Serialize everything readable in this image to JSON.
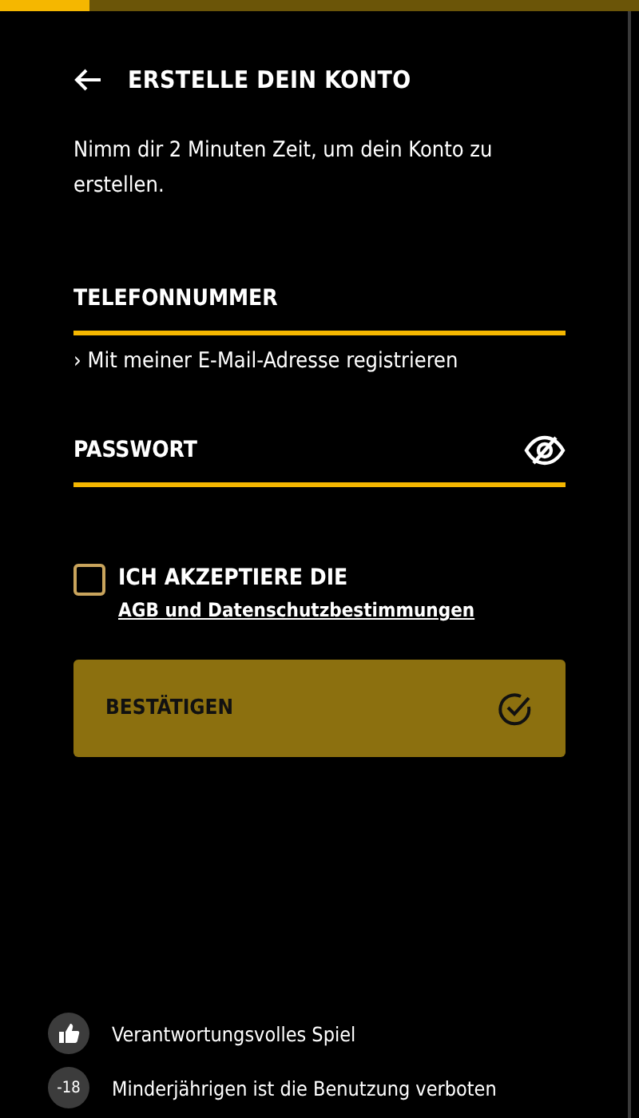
{
  "progress": {
    "level": 0.14
  },
  "header": {
    "title": "ERSTELLE DEIN KONTO"
  },
  "intro": "Nimm dir 2 Minuten Zeit, um dein Konto zu erstellen.",
  "fields": [
    {
      "kind": "phone",
      "placeholder": "TELEFONNUMMER"
    },
    {
      "kind": "password",
      "placeholder": "PASSWORT"
    }
  ],
  "alt_link": "› Mit meiner E-Mail-Adresse registrieren",
  "consent": {
    "checked": false,
    "label": "ICH AKZEPTIERE DIE",
    "link": "AGB und Datenschutzbestimmungen"
  },
  "submit": {
    "label": "BESTÄTIGEN",
    "disabled": true
  },
  "footer": [
    {
      "kind": "thumb",
      "text": "Verantwortungsvolles Spiel"
    },
    {
      "kind": "age",
      "badge": "-18",
      "text": "Minderjährigen ist die Benutzung verboten"
    }
  ]
}
